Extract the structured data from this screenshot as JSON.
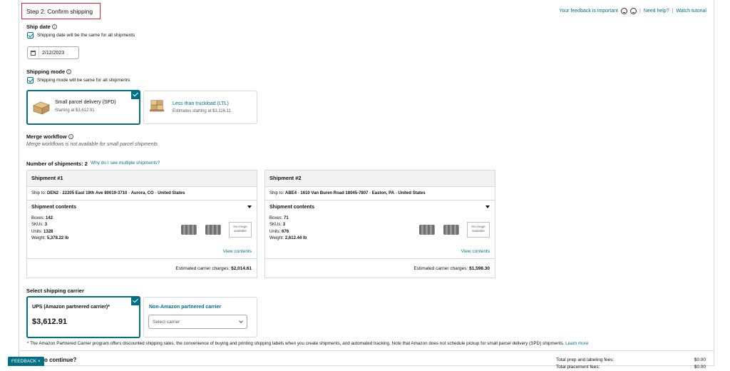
{
  "header": {
    "step_title": "Step 2: Confirm shipping",
    "feedback_link": "Your feedback is important",
    "help_link": "Need help?",
    "tutorial_link": "Watch tutorial"
  },
  "ship_date": {
    "label": "Ship date",
    "same_checkbox_label": "Shipping date will be the same for all shipments",
    "same_checked": true,
    "date_value": "2/12/2023"
  },
  "shipping_mode": {
    "label": "Shipping mode",
    "same_checkbox_label": "Shipping mode will be same for all shipments",
    "same_checked": true,
    "options": [
      {
        "title": "Small parcel delivery (SPD)",
        "subtitle": "Starting at $3,612.91",
        "selected": true
      },
      {
        "title": "Less than truckload (LTL)",
        "subtitle": "Estimates starting at $3,116.11",
        "selected": false
      }
    ]
  },
  "merge_workflow": {
    "label": "Merge workflow",
    "note": "Merge workflows is not available for small parcel shipments"
  },
  "shipments_summary": {
    "label": "Number of shipments: 2",
    "why_link": "Why do I see multiple shipments?"
  },
  "shipments": [
    {
      "title": "Shipment #1",
      "ship_to_label": "Ship to:",
      "ship_to_code": "DEN2",
      "ship_to_address": "22205 East 19th Ave 80019-3710",
      "ship_to_city": "Aurora, CO",
      "ship_to_country": "United States",
      "contents_title": "Shipment contents",
      "boxes_label": "Boxes:",
      "boxes": "142",
      "skus_label": "SKUs:",
      "skus": "3",
      "units_label": "Units:",
      "units": "1328",
      "weight_label": "Weight:",
      "weight": "5,378.22 lb",
      "no_image_text": "No image available",
      "view_contents": "View contents",
      "charges_label": "Estimated carrier charges:",
      "charges": "$2,014.61"
    },
    {
      "title": "Shipment #2",
      "ship_to_label": "Ship to:",
      "ship_to_code": "ABE4",
      "ship_to_address": "1610 Van Buren Road 18045-7807",
      "ship_to_city": "Easton, PA",
      "ship_to_country": "United States",
      "contents_title": "Shipment contents",
      "boxes_label": "Boxes:",
      "boxes": "71",
      "skus_label": "SKUs:",
      "skus": "3",
      "units_label": "Units:",
      "units": "676",
      "weight_label": "Weight:",
      "weight": "2,612.44 lb",
      "no_image_text": "No image available",
      "view_contents": "View contents",
      "charges_label": "Estimated carrier charges:",
      "charges": "$1,598.30"
    }
  ],
  "carrier": {
    "label": "Select shipping carrier",
    "partnered_name": "UPS (Amazon partnered carrier)*",
    "partnered_price": "$3,612.91",
    "partnered_selected": true,
    "non_partnered_name": "Non-Amazon partnered carrier",
    "select_placeholder": "Select carrier"
  },
  "footnote": {
    "text": "* The Amazon Partnered Carrier program offers discounted shipping rates, the convenience of buying and printing shipping labels when you create shipments, and automated tracking. Note that Amazon does not schedule pickup for small parcel delivery (SPD) shipments.",
    "link": "Learn more"
  },
  "footer": {
    "feedback_tab": "FEEDBACK",
    "continue_text": "o continue?",
    "totals_label": "Total prep and labeling fees:",
    "totals_value": "$0.00",
    "totals_label2": "Total placement fees:",
    "totals_value2": "$0.00"
  },
  "colors": {
    "accent": "#007185",
    "highlight_border": "#e3242b"
  },
  "icons": [
    "info-icon",
    "checkbox-icon",
    "calendar-icon",
    "box-icon",
    "pallet-icon",
    "chevron-down-icon",
    "smiley-icon",
    "close-icon"
  ]
}
